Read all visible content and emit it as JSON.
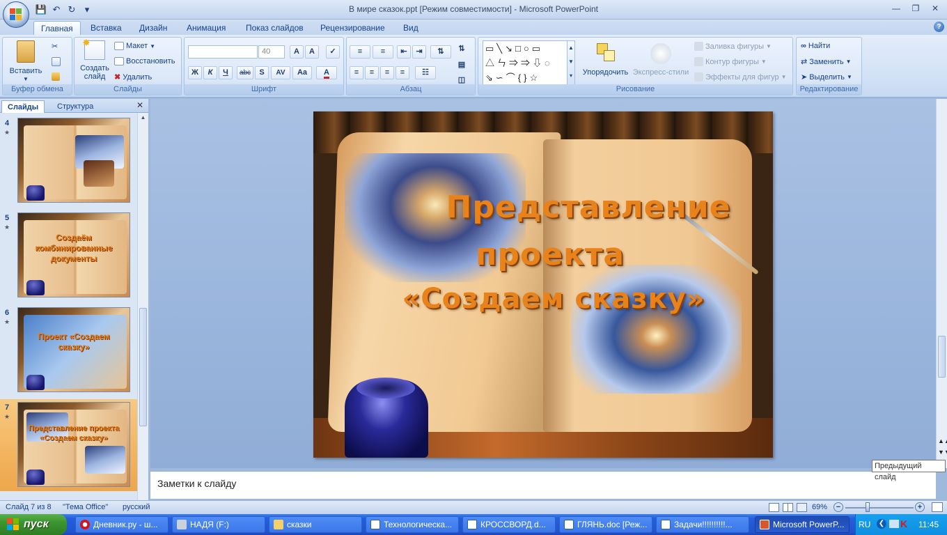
{
  "window": {
    "title": "В мире сказок.ppt [Режим совместимости] - Microsoft PowerPoint"
  },
  "qat": {
    "icons": [
      "save-icon",
      "undo-icon",
      "redo-icon",
      "customize-icon"
    ]
  },
  "tabs": [
    {
      "label": "Главная",
      "active": true
    },
    {
      "label": "Вставка"
    },
    {
      "label": "Дизайн"
    },
    {
      "label": "Анимация"
    },
    {
      "label": "Показ слайдов"
    },
    {
      "label": "Рецензирование"
    },
    {
      "label": "Вид"
    }
  ],
  "ribbon": {
    "clipboard": {
      "label": "Буфер обмена",
      "paste": "Вставить"
    },
    "slides": {
      "label": "Слайды",
      "new_slide_1": "Создать",
      "new_slide_2": "слайд",
      "layout": "Макет",
      "reset": "Восстановить",
      "delete": "Удалить"
    },
    "font": {
      "label": "Шрифт",
      "font_name": "",
      "font_size": "40",
      "bold": "Ж",
      "italic": "К",
      "underline": "Ч",
      "strike": "abc",
      "shadow": "S",
      "spacing": "AV",
      "case": "Aa"
    },
    "paragraph": {
      "label": "Абзац"
    },
    "drawing": {
      "label": "Рисование",
      "arrange": "Упорядочить",
      "quick_styles": "Экспресс-стили",
      "fill": "Заливка фигуры",
      "outline": "Контур фигуры",
      "effects": "Эффекты для фигур"
    },
    "editing": {
      "label": "Редактирование",
      "find": "Найти",
      "replace": "Заменить",
      "select": "Выделить"
    }
  },
  "left_pane": {
    "tabs": [
      "Слайды",
      "Структура"
    ],
    "thumbnails": [
      {
        "number": "4",
        "text": ""
      },
      {
        "number": "5",
        "text": "Создаём комбинированные документы"
      },
      {
        "number": "6",
        "text": "Проект «Создаем сказку»"
      },
      {
        "number": "7",
        "text": "Представление проекта «Создаем сказку»",
        "selected": true
      }
    ]
  },
  "slide": {
    "title_line1": "Представление",
    "title_line2": "проекта",
    "title_line3": "«Создаем сказку»"
  },
  "notes": {
    "placeholder": "Заметки к слайду"
  },
  "tooltip": "Предыдущий слайд",
  "status": {
    "slide": "Слайд 7 из 8",
    "theme": "\"Тема Office\"",
    "language": "русский",
    "zoom": "69%"
  },
  "taskbar": {
    "start": "пуск",
    "tasks": [
      {
        "label": "Дневник.ру - ш..."
      },
      {
        "label": "НАДЯ (F:)"
      },
      {
        "label": "сказки"
      },
      {
        "label": "Технологическа..."
      },
      {
        "label": "КРОССВОРД.d..."
      },
      {
        "label": "ГЛЯНЬ.doc [Реж..."
      },
      {
        "label": "Задачи!!!!!!!!!!..."
      },
      {
        "label": "Microsoft PowerP...",
        "active": true
      }
    ],
    "lang": "RU",
    "time": "11:45"
  },
  "colors": {
    "accent": "#15428b",
    "slide_title": "#e8821a",
    "taskbar": "#245edb",
    "start": "#3b952f"
  }
}
